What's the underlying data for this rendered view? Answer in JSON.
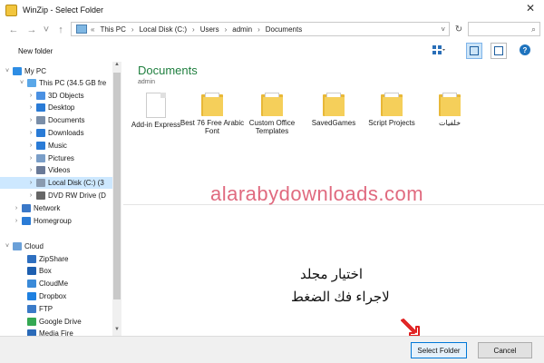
{
  "window": {
    "title": "WinZip - Select Folder",
    "close_label": "✕"
  },
  "nav": {
    "back_label": "←",
    "forward_label": "→",
    "recent_label": "˅",
    "up_label": "↑",
    "address": [
      "«",
      "This PC",
      "›",
      "Local Disk (C:)",
      "›",
      "Users",
      "›",
      "admin",
      "›",
      "Documents"
    ],
    "address_dropdown_label": "˅",
    "refresh_label": "↻",
    "search_icon_label": "⌕"
  },
  "toolbar": {
    "new_folder_label": "New folder",
    "help_label": "?"
  },
  "sidebar": {
    "items": [
      {
        "label": "My PC",
        "expander": "˅",
        "color": "#2e8de4"
      },
      {
        "label": "This PC (34.5 GB fre",
        "expander": "˅",
        "color": "#5aa7e8"
      },
      {
        "label": "3D Objects",
        "expander": "›",
        "color": "#4a90e2"
      },
      {
        "label": "Desktop",
        "expander": "›",
        "color": "#2a7bd6"
      },
      {
        "label": "Documents",
        "expander": "›",
        "color": "#7a8ea8"
      },
      {
        "label": "Downloads",
        "expander": "›",
        "color": "#2a7bd6"
      },
      {
        "label": "Music",
        "expander": "›",
        "color": "#2a7bd6"
      },
      {
        "label": "Pictures",
        "expander": "›",
        "color": "#7a9ec8"
      },
      {
        "label": "Videos",
        "expander": "›",
        "color": "#6a7a98"
      },
      {
        "label": "Local Disk (C:) (3",
        "expander": "›",
        "color": "#8a9bb0"
      },
      {
        "label": "DVD RW Drive (D",
        "expander": "›",
        "color": "#666666"
      },
      {
        "label": "Network",
        "expander": "›",
        "color": "#3a78c8"
      },
      {
        "label": "Homegroup",
        "expander": "›",
        "color": "#2a7bd6"
      },
      {
        "label": "Cloud",
        "expander": "˅",
        "color": "#6aa0d8"
      },
      {
        "label": "ZipShare",
        "expander": "",
        "color": "#2e6fc0"
      },
      {
        "label": "Box",
        "expander": "",
        "color": "#1e5fb0"
      },
      {
        "label": "CloudMe",
        "expander": "",
        "color": "#3a8ad8"
      },
      {
        "label": "Dropbox",
        "expander": "",
        "color": "#1e80e0"
      },
      {
        "label": "FTP",
        "expander": "",
        "color": "#3a7ac8"
      },
      {
        "label": "Google Drive",
        "expander": "",
        "color": "#34a853"
      },
      {
        "label": "Media Fire",
        "expander": "",
        "color": "#2a6ab8"
      }
    ]
  },
  "location": {
    "title": "Documents",
    "subtitle": "admin"
  },
  "items": [
    {
      "label": "Add-in Express",
      "kind": "doc"
    },
    {
      "label": "Best 76 Free Arabic Font",
      "kind": "folder"
    },
    {
      "label": "Custom Office Templates",
      "kind": "folder"
    },
    {
      "label": "SavedGames",
      "kind": "folder"
    },
    {
      "label": "Script Projects",
      "kind": "folder"
    },
    {
      "label": "خلفيات",
      "kind": "folder"
    }
  ],
  "overlay": {
    "watermark": "alarabydownloads.com",
    "note_line1": "اختيار مجلد",
    "note_line2": "لاجراء فك الضغط"
  },
  "footer": {
    "select_label": "Select Folder",
    "cancel_label": "Cancel"
  },
  "colors": {
    "accent": "#0078d7",
    "location_title": "#1f7f3f",
    "watermark": "#e06a7f",
    "selection": "#cde8ff"
  }
}
